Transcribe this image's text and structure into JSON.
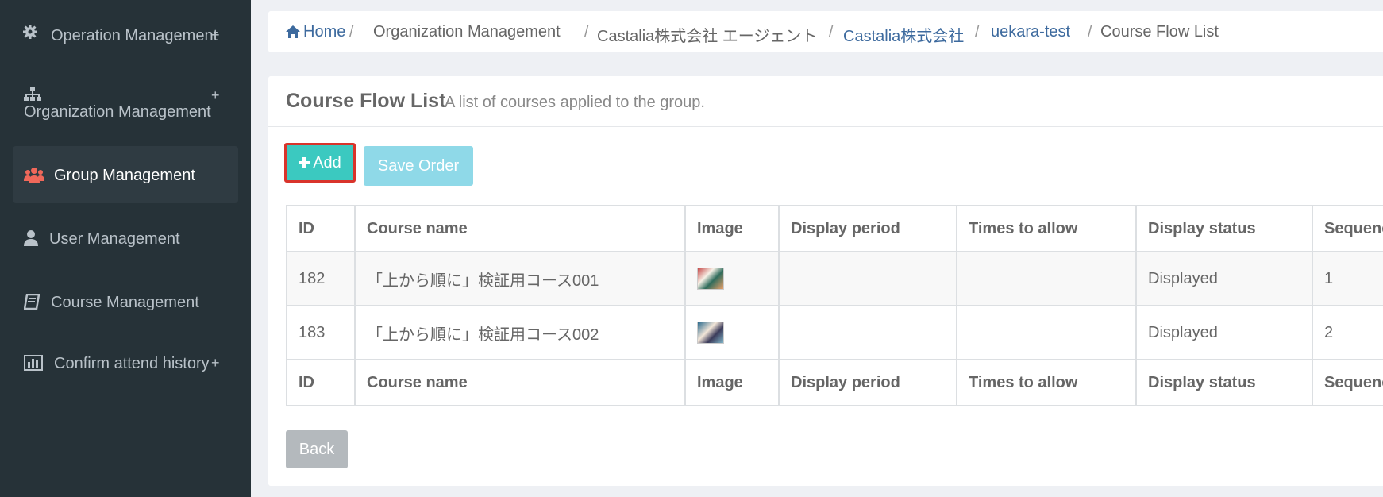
{
  "sidebar": {
    "items": [
      {
        "label": "Operation Management",
        "icon": "gear-icon",
        "expandable": true,
        "active": false
      },
      {
        "label": "Organization Management",
        "icon": "sitemap-icon",
        "expandable": true,
        "active": false
      },
      {
        "label": "Group Management",
        "icon": "users-icon",
        "expandable": false,
        "active": true
      },
      {
        "label": "User Management",
        "icon": "user-icon",
        "expandable": false,
        "active": false
      },
      {
        "label": "Course Management",
        "icon": "book-icon",
        "expandable": false,
        "active": false
      },
      {
        "label": "Confirm attend history",
        "icon": "bar-chart-icon",
        "expandable": true,
        "active": false
      }
    ],
    "plus_symbol": "+"
  },
  "breadcrumb": {
    "home": "Home",
    "items": [
      "Organization Management",
      "Castalia株式会社 エージェント",
      "Castalia株式会社",
      "uekara-test",
      "Course Flow List"
    ],
    "separator": "/"
  },
  "panel": {
    "title": "Course Flow List",
    "subtitle": "A list of courses applied to the group."
  },
  "buttons": {
    "add_label": "Add",
    "save_order_label": "Save Order",
    "back_label": "Back"
  },
  "table": {
    "headers": [
      "ID",
      "Course name",
      "Image",
      "Display period",
      "Times to allow",
      "Display status",
      "Sequence"
    ],
    "rows": [
      {
        "id": "182",
        "course_name": "「上から順に」検証用コース001",
        "display_period": "",
        "times_to_allow": "",
        "display_status": "Displayed",
        "sequence": "1"
      },
      {
        "id": "183",
        "course_name": "「上から順に」検証用コース002",
        "display_period": "",
        "times_to_allow": "",
        "display_status": "Displayed",
        "sequence": "2"
      }
    ]
  },
  "colors": {
    "sidebar_bg": "#263238",
    "add_button": "#3bc9c0",
    "save_button": "#8fd9e8",
    "link": "#3d6a9e",
    "users_icon": "#f0685a"
  }
}
